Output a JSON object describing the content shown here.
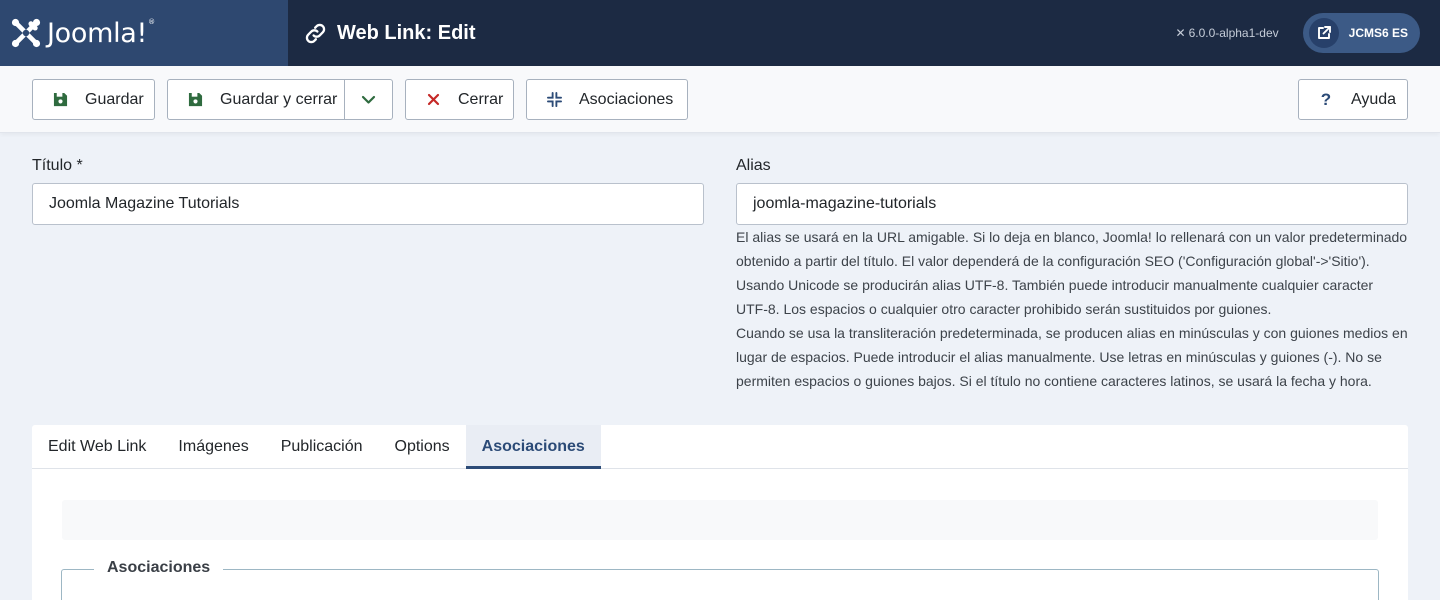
{
  "header": {
    "logo_text": "Joomla!",
    "title": "Web Link: Edit",
    "version": "6.0.0-alpha1-dev",
    "site_button": "JCMS6 ES",
    "colors": {
      "header_bg": "#1c2a43",
      "logo_bg": "#2e4870",
      "accent": "#2c4b77"
    }
  },
  "toolbar": {
    "save": "Guardar",
    "save_close": "Guardar y cerrar",
    "close": "Cerrar",
    "associations": "Asociaciones",
    "help": "Ayuda"
  },
  "form": {
    "title_label": "Título *",
    "title_value": "Joomla Magazine Tutorials",
    "alias_label": "Alias",
    "alias_value": "joomla-magazine-tutorials",
    "alias_help_1": "El alias se usará en la URL amigable. Si lo deja en blanco, Joomla! lo rellenará con un valor predeterminado obtenido a partir del título. El valor dependerá de la configuración SEO ('Configuración global'->'Sitio'). Usando Unicode se producirán alias UTF-8. También puede introducir manualmente cualquier caracter UTF-8. Los espacios o cualquier otro caracter prohibido serán sustituidos por guiones.",
    "alias_help_2": "Cuando se usa la transliteración predeterminada, se producen alias en minúsculas y con guiones medios en lugar de espacios. Puede introducir el alias manualmente. Use letras en minúsculas y guiones (-). No se permiten espacios o guiones bajos. Si el título no contiene caracteres latinos, se usará la fecha y hora."
  },
  "tabs": [
    {
      "label": "Edit Web Link"
    },
    {
      "label": "Imágenes"
    },
    {
      "label": "Publicación"
    },
    {
      "label": "Options"
    },
    {
      "label": "Asociaciones",
      "active": true
    }
  ],
  "panel": {
    "fieldset_legend": "Asociaciones"
  }
}
